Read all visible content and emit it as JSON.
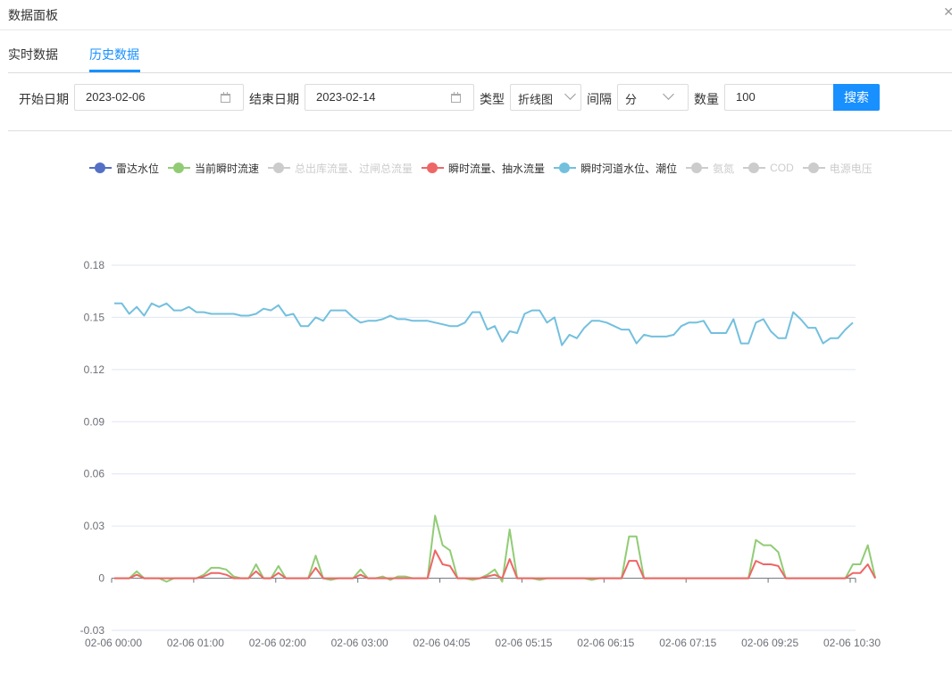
{
  "window": {
    "title": "数据面板",
    "close_icon": "close-icon"
  },
  "tabs": [
    {
      "label": "实时数据",
      "active": false
    },
    {
      "label": "历史数据",
      "active": true
    }
  ],
  "filters": {
    "start_label": "开始日期",
    "start_value": "2023-02-06",
    "end_label": "结束日期",
    "end_value": "2023-02-14",
    "type_label": "类型",
    "type_value": "折线图",
    "interval_label": "间隔",
    "interval_value": "分",
    "count_label": "数量",
    "count_value": "100",
    "search_label": "搜索"
  },
  "colors": {
    "accent": "#1890ff",
    "radar": "#5470c6",
    "flow_speed": "#91cc75",
    "inactive": "#cccccc",
    "instant_flow": "#ee6666",
    "river_level": "#73c0de"
  },
  "chart_data": {
    "type": "line",
    "title": "",
    "xlabel": "",
    "ylabel": "",
    "ylim": [
      -0.03,
      0.18
    ],
    "yticks": [
      "-0.03",
      "0",
      "0.03",
      "0.06",
      "0.09",
      "0.12",
      "0.15",
      "0.18"
    ],
    "ytick_values": [
      -0.03,
      0,
      0.03,
      0.06,
      0.09,
      0.12,
      0.15,
      0.18
    ],
    "xtick_labels": [
      "02-06 00:00",
      "02-06 01:00",
      "02-06 02:00",
      "02-06 03:00",
      "02-06 04:05",
      "02-06 05:15",
      "02-06 06:15",
      "02-06 07:15",
      "02-06 09:25",
      "02-06 10:30"
    ],
    "xtick_indices": [
      0,
      11,
      22,
      33,
      44,
      55,
      66,
      77,
      88,
      99
    ],
    "grid": true,
    "legend_position": "top",
    "n_points": 100,
    "legend": [
      {
        "name": "雷达水位",
        "color": "#5470c6",
        "active": true
      },
      {
        "name": "当前瞬时流速",
        "color": "#91cc75",
        "active": true
      },
      {
        "name": "总出库流量、过闸总流量",
        "color": "#cccccc",
        "active": false
      },
      {
        "name": "瞬时流量、抽水流量",
        "color": "#ee6666",
        "active": true
      },
      {
        "name": "瞬时河道水位、潮位",
        "color": "#73c0de",
        "active": true
      },
      {
        "name": "氨氮",
        "color": "#cccccc",
        "active": false
      },
      {
        "name": "COD",
        "color": "#cccccc",
        "active": false
      },
      {
        "name": "电源电压",
        "color": "#cccccc",
        "active": false
      }
    ],
    "series": [
      {
        "name": "瞬时河道水位、潮位",
        "color": "#73c0de",
        "values": [
          0.158,
          0.158,
          0.152,
          0.156,
          0.151,
          0.158,
          0.156,
          0.158,
          0.154,
          0.154,
          0.156,
          0.153,
          0.153,
          0.152,
          0.152,
          0.152,
          0.152,
          0.151,
          0.151,
          0.152,
          0.155,
          0.154,
          0.157,
          0.151,
          0.152,
          0.145,
          0.145,
          0.15,
          0.148,
          0.154,
          0.154,
          0.154,
          0.15,
          0.147,
          0.148,
          0.148,
          0.149,
          0.151,
          0.149,
          0.149,
          0.148,
          0.148,
          0.148,
          0.147,
          0.146,
          0.145,
          0.145,
          0.147,
          0.153,
          0.153,
          0.143,
          0.145,
          0.136,
          0.142,
          0.141,
          0.152,
          0.154,
          0.154,
          0.147,
          0.15,
          0.134,
          0.14,
          0.138,
          0.144,
          0.148,
          0.148,
          0.147,
          0.145,
          0.143,
          0.143,
          0.135,
          0.14,
          0.139,
          0.139,
          0.139,
          0.14,
          0.145,
          0.147,
          0.147,
          0.148,
          0.141,
          0.141,
          0.141,
          0.149,
          0.135,
          0.135,
          0.147,
          0.149,
          0.142,
          0.138,
          0.138,
          0.153,
          0.149,
          0.144,
          0.144,
          0.135,
          0.138,
          0.138,
          0.143,
          0.147
        ]
      },
      {
        "name": "当前瞬时流速",
        "color": "#91cc75",
        "values": [
          0,
          0,
          0,
          0.004,
          0,
          0,
          0,
          -0.002,
          0,
          0,
          0,
          0,
          0.002,
          0.006,
          0.006,
          0.005,
          0.001,
          0,
          0,
          0.008,
          0,
          0,
          0.007,
          0,
          0,
          0,
          0,
          0.013,
          0,
          -0.001,
          0,
          0,
          0,
          0.005,
          0,
          0,
          0.001,
          -0.001,
          0.001,
          0.001,
          0,
          0,
          0,
          0.036,
          0.019,
          0.016,
          0,
          0,
          -0.001,
          0,
          0.002,
          0.005,
          -0.002,
          0.028,
          0,
          0,
          0,
          -0.001,
          0,
          0,
          0,
          0,
          0,
          0,
          -0.001,
          0,
          0,
          0,
          0,
          0.024,
          0.024,
          0,
          0,
          0,
          0,
          0,
          0,
          0,
          0,
          0,
          0,
          0,
          0,
          0,
          0,
          0,
          0.022,
          0.019,
          0.019,
          0.015,
          0,
          0,
          0,
          0,
          0,
          0,
          0,
          0,
          0,
          0.008,
          0.008,
          0.019,
          0
        ]
      },
      {
        "name": "瞬时流量、抽水流量",
        "color": "#ee6666",
        "values": [
          0,
          0,
          0,
          0.002,
          0,
          0,
          0,
          0,
          0,
          0,
          0,
          0,
          0.001,
          0.003,
          0.003,
          0.002,
          0,
          0,
          0,
          0.004,
          0,
          0,
          0.003,
          0,
          0,
          0,
          0,
          0.006,
          0,
          0,
          0,
          0,
          0,
          0.002,
          0,
          0,
          0,
          0,
          0,
          0,
          0,
          0,
          0,
          0.016,
          0.008,
          0.007,
          0,
          0,
          0,
          0,
          0.001,
          0.002,
          0,
          0.011,
          0,
          0,
          0,
          0,
          0,
          0,
          0,
          0,
          0,
          0,
          0,
          0,
          0,
          0,
          0,
          0.01,
          0.01,
          0,
          0,
          0,
          0,
          0,
          0,
          0,
          0,
          0,
          0,
          0,
          0,
          0,
          0,
          0,
          0.01,
          0.008,
          0.008,
          0.007,
          0,
          0,
          0,
          0,
          0,
          0,
          0,
          0,
          0,
          0.003,
          0.003,
          0.008,
          0
        ]
      }
    ]
  }
}
